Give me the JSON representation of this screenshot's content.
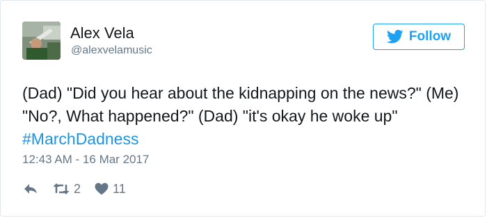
{
  "user": {
    "name": "Alex Vela",
    "handle": "@alexvelamusic"
  },
  "follow_button": {
    "label": "Follow",
    "icon": "twitter-bird-icon"
  },
  "tweet": {
    "text": "(Dad) \"Did you hear about the kidnapping on the news?\" (Me) \"No?, What happened?\" (Dad) \"it's okay he woke up\" ",
    "hashtag": "#MarchDadness",
    "timestamp": "12:43 AM - 16 Mar 2017"
  },
  "actions": {
    "reply_icon": "reply-icon",
    "retweet_icon": "retweet-icon",
    "retweet_count": "2",
    "like_icon": "heart-icon",
    "like_count": "11"
  },
  "colors": {
    "accent": "#1da1f2",
    "hashtag": "#1b95e0",
    "secondary_text": "#657786",
    "border": "#e1e8ed"
  }
}
